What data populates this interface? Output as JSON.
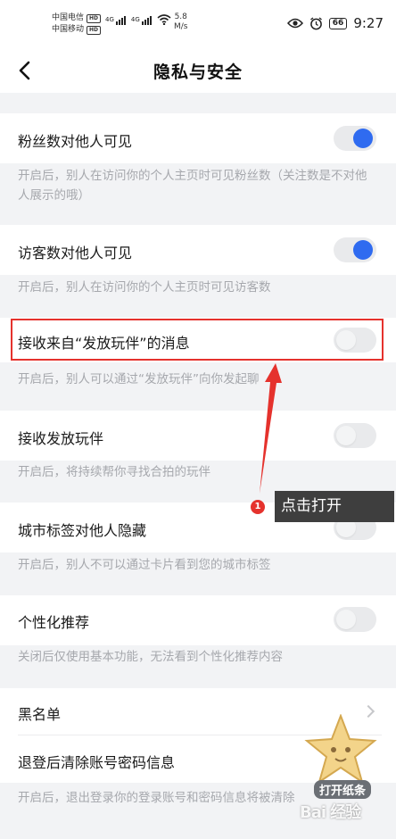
{
  "status_bar": {
    "carrier_1": "中国电信",
    "carrier_2": "中国移动",
    "hd_badge": "HD",
    "network_1": "4G",
    "network_2": "4G",
    "speed_value": "5.8",
    "speed_unit": "M/s",
    "battery": "66",
    "time": "9:27"
  },
  "header": {
    "title": "隐私与安全",
    "back_icon": "back-arrow-icon"
  },
  "settings": [
    {
      "label": "粉丝数对他人可见",
      "toggle": true,
      "desc": "开启后，别人在访问你的个人主页时可见粉丝数（关注数是不对他人展示的哦）"
    },
    {
      "label": "访客数对他人可见",
      "toggle": true,
      "desc": "开启后，别人在访问你的个人主页时可见访客数"
    },
    {
      "label": "接收来自“发放玩伴”的消息",
      "toggle": false,
      "desc": "开启后，别人可以通过“发放玩伴”向你发起聊"
    },
    {
      "label": "接收发放玩伴",
      "toggle": false,
      "desc": "开启后，将持续帮你寻找合拍的玩伴"
    },
    {
      "label": "城市标签对他人隐藏",
      "toggle": false,
      "desc": "开启后，别人不可以通过卡片看到您的城市标签"
    },
    {
      "label": "个性化推荐",
      "toggle": false,
      "desc": "关闭后仅使用基本功能，无法看到个性化推荐内容"
    }
  ],
  "blacklist": {
    "label": "黑名单",
    "icon": "chevron-right-icon"
  },
  "clear_on_logout": {
    "label": "退登后清除账号密码信息",
    "desc": "开启后，退出登录你的登录账号和密码信息将被清除"
  },
  "annotation": {
    "step_number": "1",
    "tip_text": "点击打开",
    "highlight_color": "#e5322d"
  },
  "watermark": {
    "badge_label": "打开纸条",
    "brand_text": "Bai 经验"
  },
  "colors": {
    "toggle_on": "#2f6bf0",
    "toggle_off_track": "#e9eaec",
    "background": "#f2f3f5",
    "desc_text": "#a6a8ad"
  }
}
